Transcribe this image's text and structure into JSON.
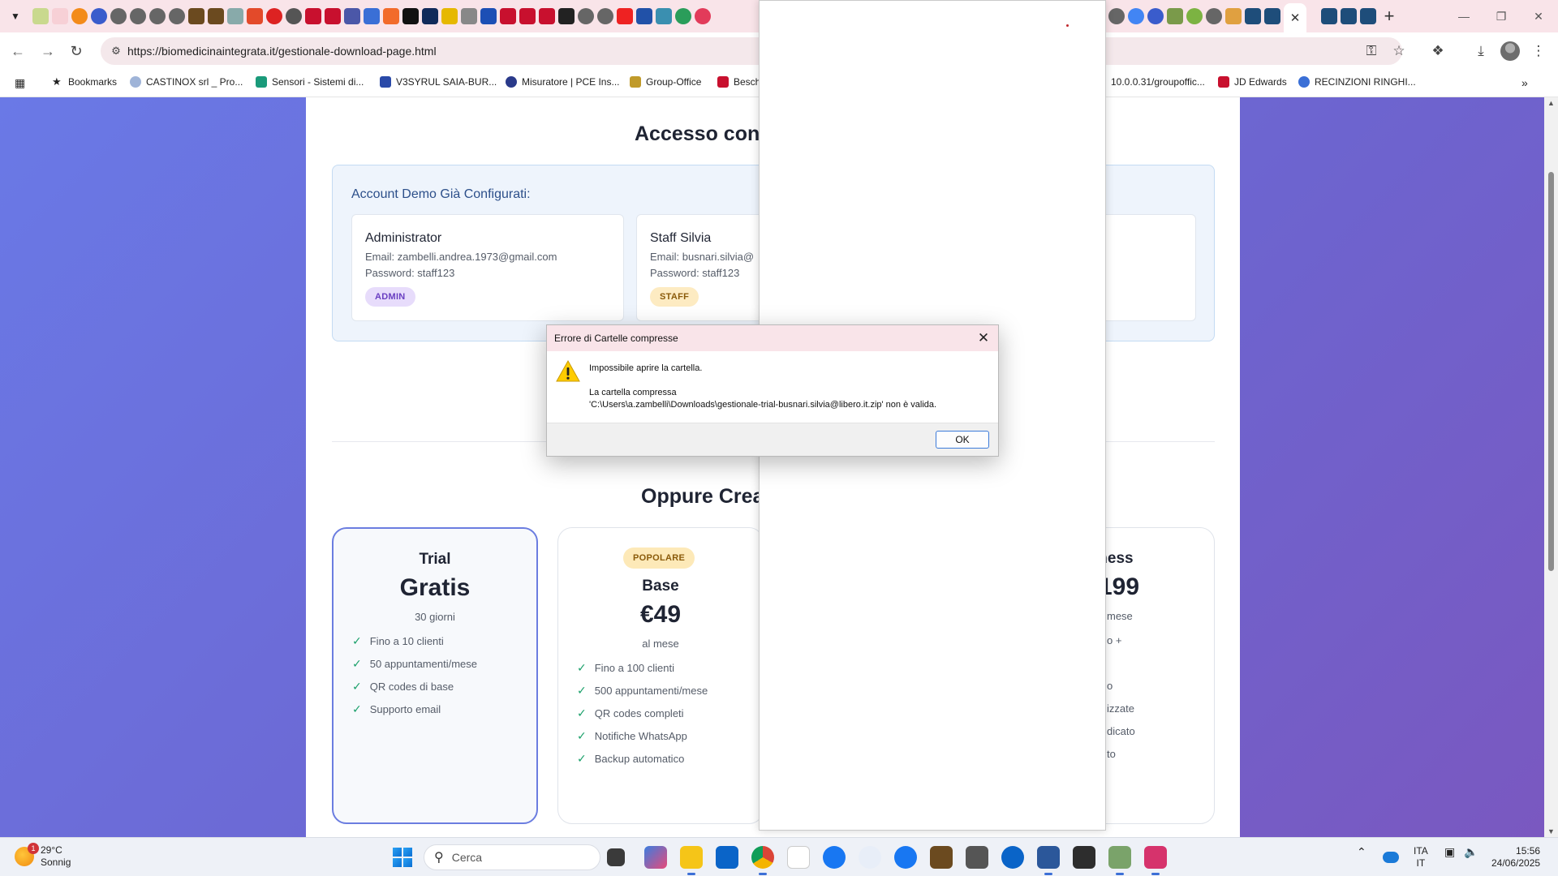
{
  "browser": {
    "url": "https://biomedicinaintegrata.it/gestionale-download-page.html",
    "bookmarks": [
      {
        "label": "Bookmarks",
        "icon": "star-icon"
      },
      {
        "label": "CASTINOX srl _ Pro...",
        "icon": "castinox-icon"
      },
      {
        "label": "Sensori - Sistemi di...",
        "icon": "sensori-icon"
      },
      {
        "label": "V3SYRUL SAIA-BUR...",
        "icon": "saia-icon"
      },
      {
        "label": "Misuratore | PCE Ins...",
        "icon": "pce-icon"
      },
      {
        "label": "Group-Office",
        "icon": "group-office-icon"
      },
      {
        "label": "Besch",
        "icon": "besch-icon"
      },
      {
        "label": "10.0.0.31/groupoffic...",
        "icon": "globe-icon"
      },
      {
        "label": "JD Edwards",
        "icon": "jde-icon"
      },
      {
        "label": "RECINZIONI RINGHI...",
        "icon": "recinzioni-icon"
      }
    ]
  },
  "page": {
    "access_title": "Accesso con A",
    "demo_title": "Account Demo Già Configurati:",
    "accounts": [
      {
        "name": "Administrator",
        "email": "Email: zambelli.andrea.1973@gmail.com",
        "password": "Password: staff123",
        "role": "ADMIN"
      },
      {
        "name": "Staff Silvia",
        "email": "Email: busnari.silvia@",
        "password": "Password: staff123",
        "role": "STAFF"
      }
    ],
    "plans_title": "Oppure Crea",
    "plans": [
      {
        "name": "Trial",
        "price": "Gratis",
        "period": "30 giorni",
        "features": [
          "Fino a 10 clienti",
          "50 appuntamenti/mese",
          "QR codes di base",
          "Supporto email"
        ]
      },
      {
        "badge": "POPOLARE",
        "name": "Base",
        "price": "€49",
        "period": "al mese",
        "features": [
          "Fino a 100 clienti",
          "500 appuntamenti/mese",
          "QR codes completi",
          "Notifiche WhatsApp",
          "Backup automatico"
        ]
      },
      {
        "name": "iness",
        "price": "199",
        "period": "mese",
        "features": [
          "o +",
          "",
          "o",
          "izzate",
          "dicato",
          "to"
        ]
      }
    ]
  },
  "dialog": {
    "title": "Errore di Cartelle compresse",
    "line1": "Impossibile aprire la cartella.",
    "line2": "La cartella compressa",
    "line3": "'C:\\Users\\a.zambelli\\Downloads\\gestionale-trial-busnari.silvia@libero.it.zip' non è valida.",
    "ok": "OK"
  },
  "taskbar": {
    "temperature": "29°C",
    "weather": "Sonnig",
    "notification_count": "1",
    "search_placeholder": "Cerca",
    "lang_top": "ITA",
    "lang_bottom": "IT",
    "time": "15:56",
    "date": "24/06/2025"
  },
  "colors": {
    "accent": "#6b7de0",
    "tab_strip": "#f9e4e9",
    "page_gradient_start": "#6a79e6",
    "page_gradient_end": "#7a58c0"
  }
}
